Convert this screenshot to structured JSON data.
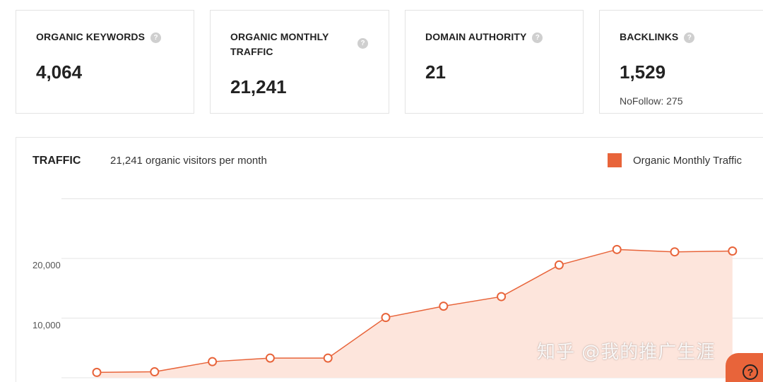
{
  "cards": [
    {
      "title": "ORGANIC KEYWORDS",
      "value": "4,064",
      "sub": ""
    },
    {
      "title": "ORGANIC MONTHLY TRAFFIC",
      "value": "21,241",
      "sub": ""
    },
    {
      "title": "DOMAIN AUTHORITY",
      "value": "21",
      "sub": ""
    },
    {
      "title": "BACKLINKS",
      "value": "1,529",
      "sub": "NoFollow: 275"
    }
  ],
  "help_glyph": "?",
  "traffic": {
    "title": "TRAFFIC",
    "subtitle": "21,241 organic visitors per month",
    "legend_label": "Organic Monthly Traffic"
  },
  "colors": {
    "accent": "#e8643a",
    "area_fill": "#fde5dc"
  },
  "chart_data": {
    "type": "area",
    "series": [
      {
        "name": "Organic Monthly Traffic",
        "values": [
          900,
          1000,
          2700,
          3300,
          3300,
          10100,
          12000,
          13600,
          18900,
          21500,
          21100,
          21241
        ]
      }
    ],
    "ylim": [
      0,
      30000
    ],
    "yticks": [
      "20,000",
      "10,000"
    ],
    "grid": true,
    "legend": "top-right"
  },
  "watermark": "知乎 @我的推广生涯"
}
